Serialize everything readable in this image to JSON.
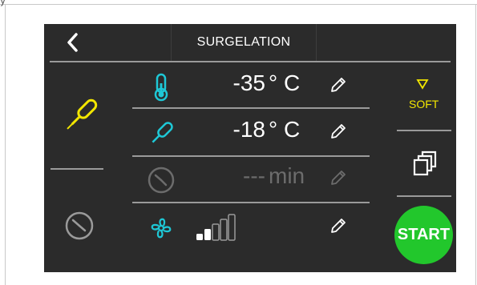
{
  "screen": {
    "title": "SURGELATION",
    "colors": {
      "background": "#2b2b2b",
      "accent_cyan": "#1ec8d6",
      "accent_yellow": "#f2e600",
      "start_green": "#22c72c",
      "dim": "#6c6c6c"
    }
  },
  "corner_fragment": "y",
  "rows": [
    {
      "icon": "thermometer-icon",
      "value": "-35",
      "unit": "° C",
      "enabled": true
    },
    {
      "icon": "probe-icon",
      "value": "-18",
      "unit": "° C",
      "enabled": true
    },
    {
      "icon": "timer-icon",
      "value": "---",
      "unit": "min",
      "enabled": false
    },
    {
      "icon": "fan-icon",
      "fan_level": 2,
      "fan_levels_total": 5,
      "enabled": true
    }
  ],
  "left_modes": [
    {
      "icon": "probe-icon",
      "selected": true
    },
    {
      "icon": "timer-icon",
      "selected": false
    }
  ],
  "right_controls": {
    "soft_label": "SOFT",
    "soft_icon": "triangle-down-icon",
    "copy_icon": "layers-icon",
    "start_label": "START"
  }
}
